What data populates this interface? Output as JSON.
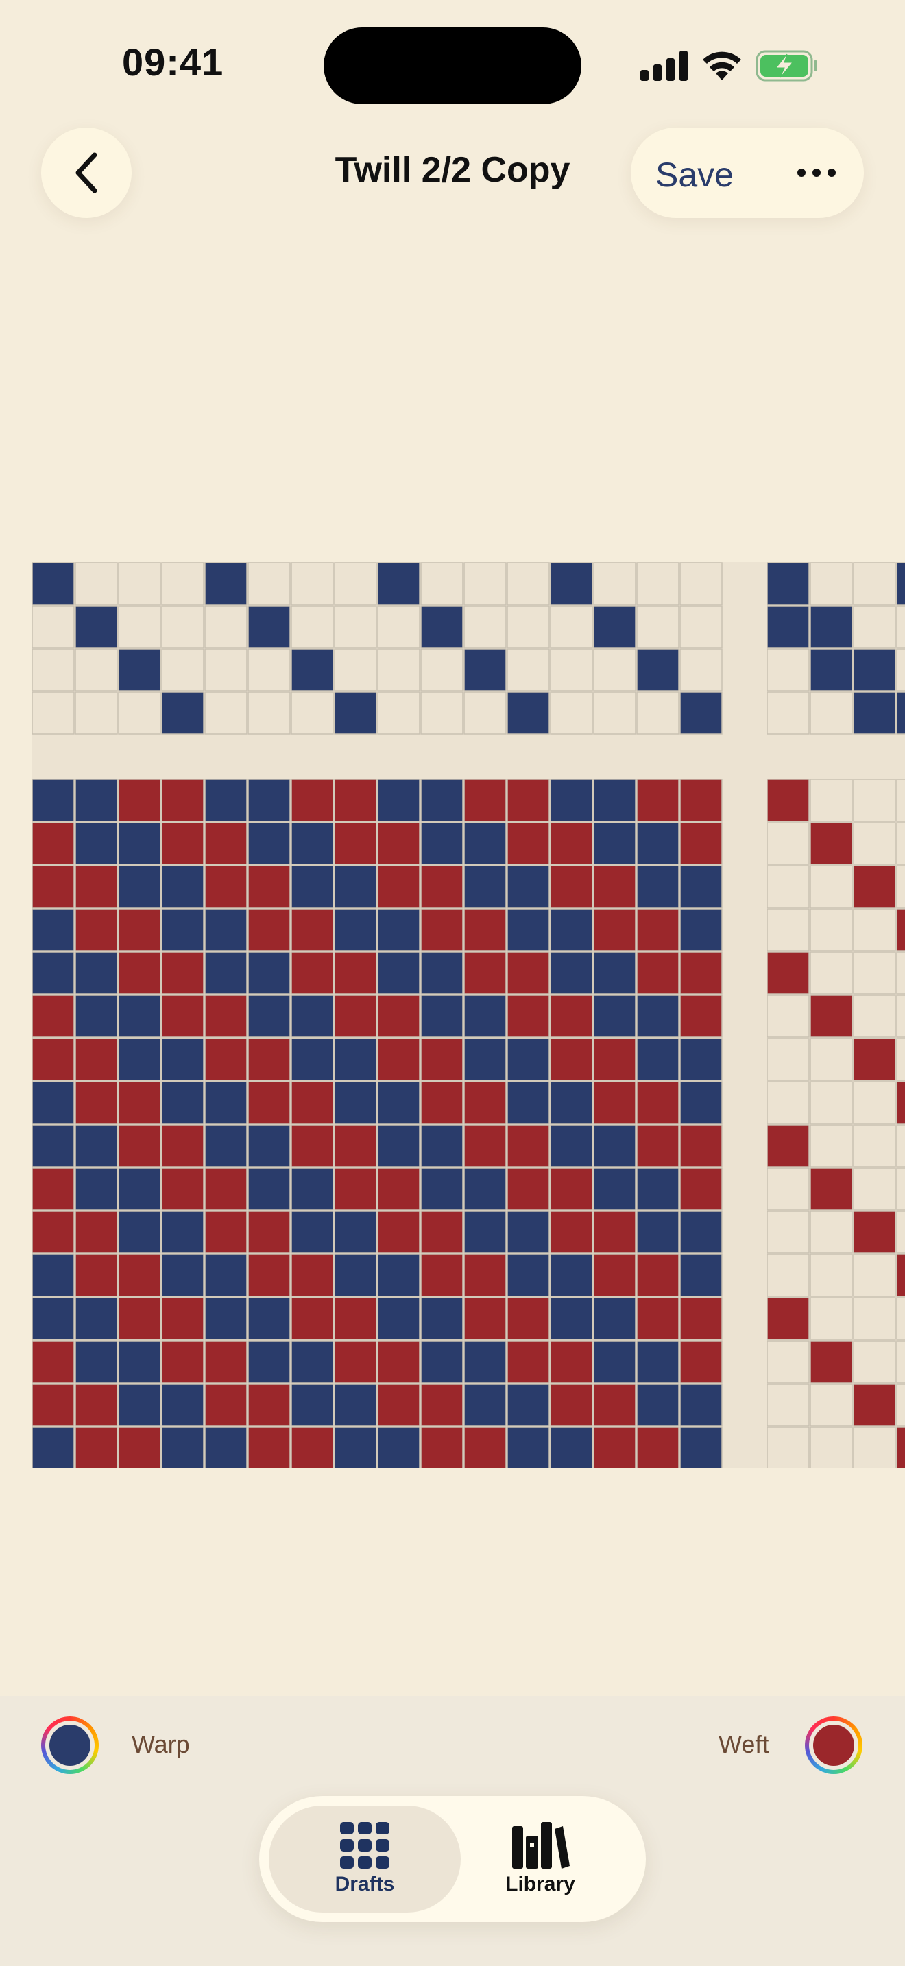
{
  "status_bar": {
    "time": "09:41"
  },
  "nav": {
    "back_icon": "chevron-left-icon",
    "title": "Twill 2/2 Copy",
    "save_label": "Save",
    "more_icon": "ellipsis-icon"
  },
  "colors": {
    "background": "#f5eddb",
    "warp": "#2a3c6b",
    "weft": "#9b272b",
    "empty_cell": "#ece3d2",
    "accent_text": "#2a3c6b"
  },
  "draft": {
    "threading_rows": [
      "1000100010001000",
      "0100010001000100",
      "0010001000100010",
      "0001000100010001"
    ],
    "tieup_partial": [
      "1001",
      "1100",
      "0110",
      "0011"
    ],
    "treadling_pattern": [
      "1000",
      "0100",
      "0010",
      "0001"
    ],
    "treadling_repeats": 4,
    "drawdown_rows": [
      "1100110011001100",
      "0110011001100110",
      "0011001100110011",
      "1001100110011001"
    ],
    "drawdown_repeats": 4
  },
  "color_picker": {
    "warp_label": "Warp",
    "weft_label": "Weft"
  },
  "tab_bar": {
    "tabs": [
      {
        "label": "Drafts",
        "icon": "grid-icon",
        "active": true
      },
      {
        "label": "Library",
        "icon": "books-icon",
        "active": false
      }
    ]
  }
}
